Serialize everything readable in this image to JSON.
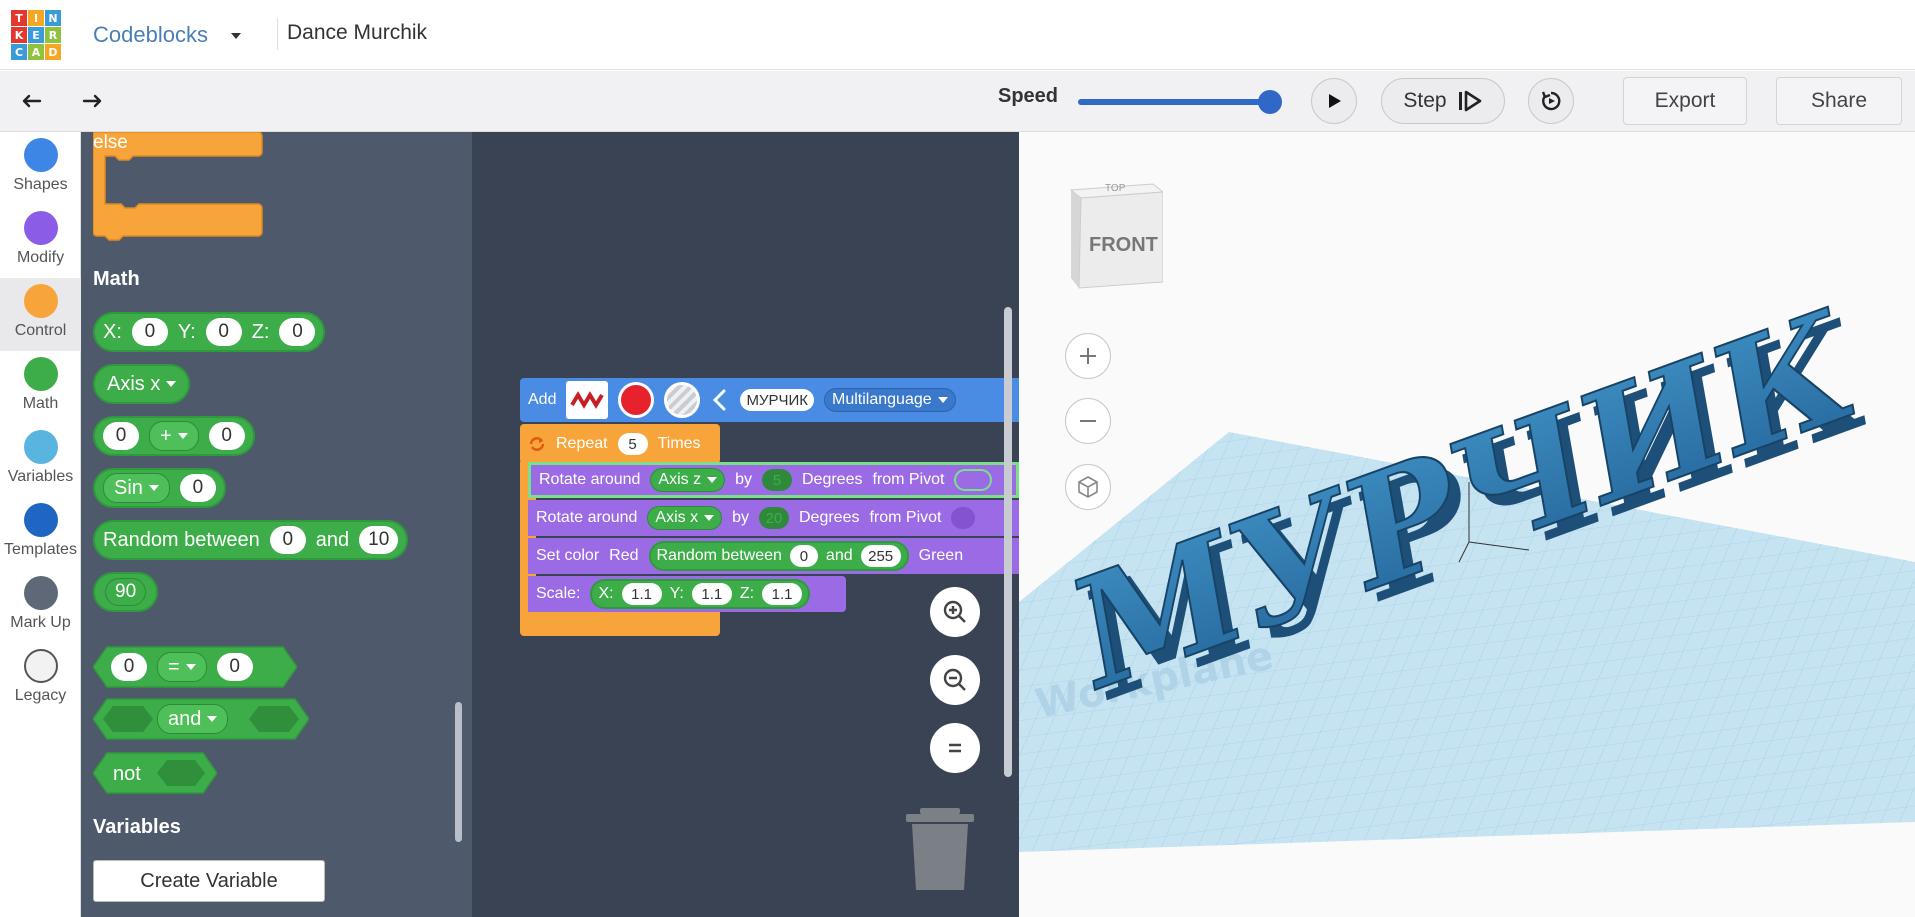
{
  "app": {
    "logo_letters": [
      "T",
      "I",
      "N",
      "K",
      "E",
      "R",
      "C",
      "A",
      "D"
    ],
    "logo_colors": [
      "#e2382d",
      "#f5a623",
      "#3a9bd9",
      "#e2382d",
      "#3a9bd9",
      "#8fc33e",
      "#3a9bd9",
      "#8fc33e",
      "#f5a623"
    ],
    "mode": "Codeblocks",
    "project_name": "Dance Murchik"
  },
  "toolbar": {
    "undo_icon": "undo-icon",
    "redo_icon": "redo-icon",
    "speed_label": "Speed",
    "speed_value": 1.0,
    "play_icon": "play-icon",
    "step_label": "Step",
    "reset_icon": "reset-icon",
    "export_label": "Export",
    "share_label": "Share"
  },
  "categories": [
    {
      "label": "Shapes",
      "color": "#3e86e6"
    },
    {
      "label": "Modify",
      "color": "#8b5de6"
    },
    {
      "label": "Control",
      "color": "#f7a43b",
      "active": true
    },
    {
      "label": "Math",
      "color": "#3dad49"
    },
    {
      "label": "Variables",
      "color": "#5ab4e0"
    },
    {
      "label": "Templates",
      "color": "#1f66c3"
    },
    {
      "label": "Mark Up",
      "color": "#5f6877"
    },
    {
      "label": "Legacy",
      "color": "#f2f2f2"
    }
  ],
  "flyout": {
    "else_label": "else",
    "math_heading": "Math",
    "xyz": {
      "x_label": "X:",
      "x": "0",
      "y_label": "Y:",
      "y": "0",
      "z_label": "Z:",
      "z": "0"
    },
    "axis_block": "Axis x",
    "arith": {
      "a": "0",
      "op": "+",
      "b": "0"
    },
    "sin": {
      "fn": "Sin",
      "v": "0"
    },
    "random": {
      "label": "Random between",
      "a": "0",
      "and": "and",
      "b": "10"
    },
    "number": "90",
    "compare": {
      "a": "0",
      "op": "=",
      "b": "0"
    },
    "logic_and": "and",
    "not_label": "not",
    "variables_heading": "Variables",
    "create_variable": "Create Variable"
  },
  "workspace": {
    "add": {
      "label": "Add",
      "text": "МУРЧИК",
      "font": "Multilanguage"
    },
    "repeat": {
      "label": "Repeat",
      "count": "5",
      "times": "Times"
    },
    "rot1": {
      "label": "Rotate around",
      "axis": "Axis z",
      "by": "by",
      "deg": "5",
      "degrees": "Degrees",
      "from": "from Pivot"
    },
    "rot2": {
      "label": "Rotate around",
      "axis": "Axis x",
      "by": "by",
      "deg": "20",
      "degrees": "Degrees",
      "from": "from Pivot"
    },
    "color": {
      "label": "Set color",
      "red": "Red",
      "random": "Random between",
      "a": "0",
      "and": "and",
      "b": "255",
      "green": "Green"
    },
    "scale": {
      "label": "Scale:",
      "x_label": "X:",
      "x": "1.1",
      "y_label": "Y:",
      "y": "1.1",
      "z_label": "Z:",
      "z": "1.1"
    }
  },
  "viewport": {
    "viewcube_label": "FRONT",
    "viewcube_top": "TOP",
    "model_text": "МУРЧИК",
    "plane_label": "Workplane"
  }
}
